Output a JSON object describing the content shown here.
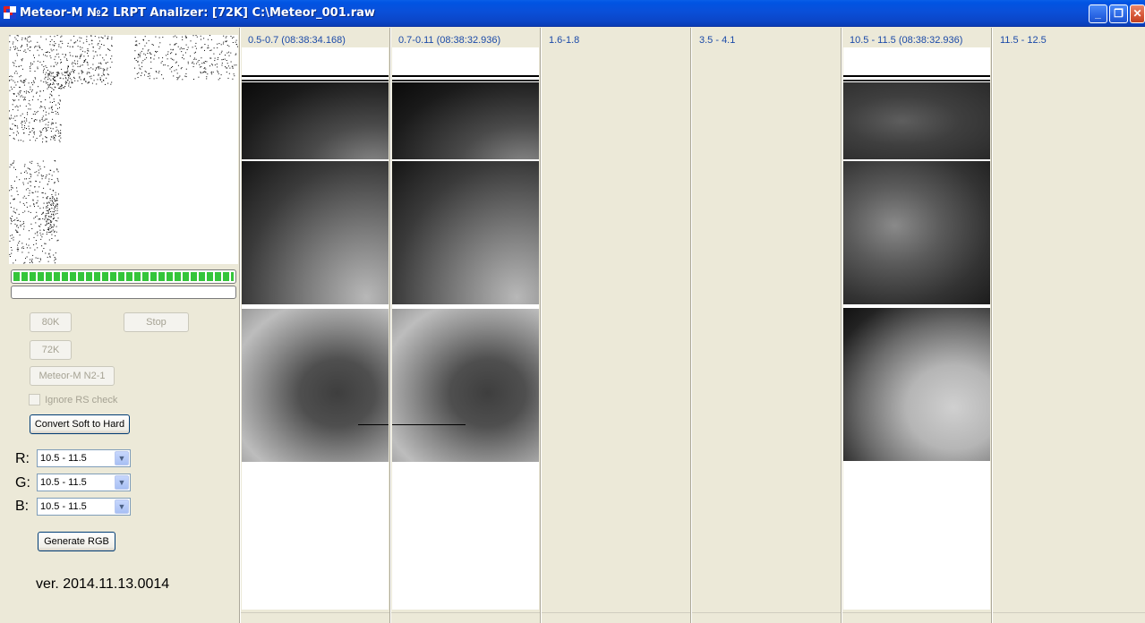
{
  "window": {
    "title": "Meteor-M №2 LRPT Analizer: [72K] C:\\Meteor_001.raw",
    "minimize_glyph": "_",
    "maximize_glyph": "❐",
    "close_glyph": "✕"
  },
  "left_panel": {
    "sync_progress_fraction": 1.0,
    "read_progress_fraction": 0.0,
    "buttons": {
      "rate_80k": "80K",
      "stop": "Stop",
      "rate_72k": "72K",
      "meteor_n2_1": "Meteor-M N2-1",
      "convert": "Convert Soft to Hard",
      "generate_rgb": "Generate RGB"
    },
    "ignore_rs_label": "Ignore RS check",
    "ignore_rs_checked": false,
    "rgb": {
      "r_label": "R:",
      "g_label": "G:",
      "b_label": "B:",
      "r_value": "10.5 - 11.5",
      "g_value": "10.5 - 11.5",
      "b_value": "10.5 - 11.5"
    },
    "version": "ver. 2014.11.13.0014"
  },
  "channels": [
    {
      "label": "0.5-0.7 (08:38:34.168)",
      "has_image": true
    },
    {
      "label": "0.7-0.11 (08:38:32.936)",
      "has_image": true
    },
    {
      "label": "1.6-1.8",
      "has_image": false
    },
    {
      "label": "3.5 - 4.1",
      "has_image": false
    },
    {
      "label": "10.5 - 11.5 (08:38:32.936)",
      "has_image": true
    },
    {
      "label": "11.5 - 12.5",
      "has_image": false
    }
  ],
  "colors": {
    "titlebar": "#0054e3",
    "panel_bg": "#ece9d8",
    "channel_label": "#1b4aa8",
    "progress_green": "#34c53a"
  }
}
